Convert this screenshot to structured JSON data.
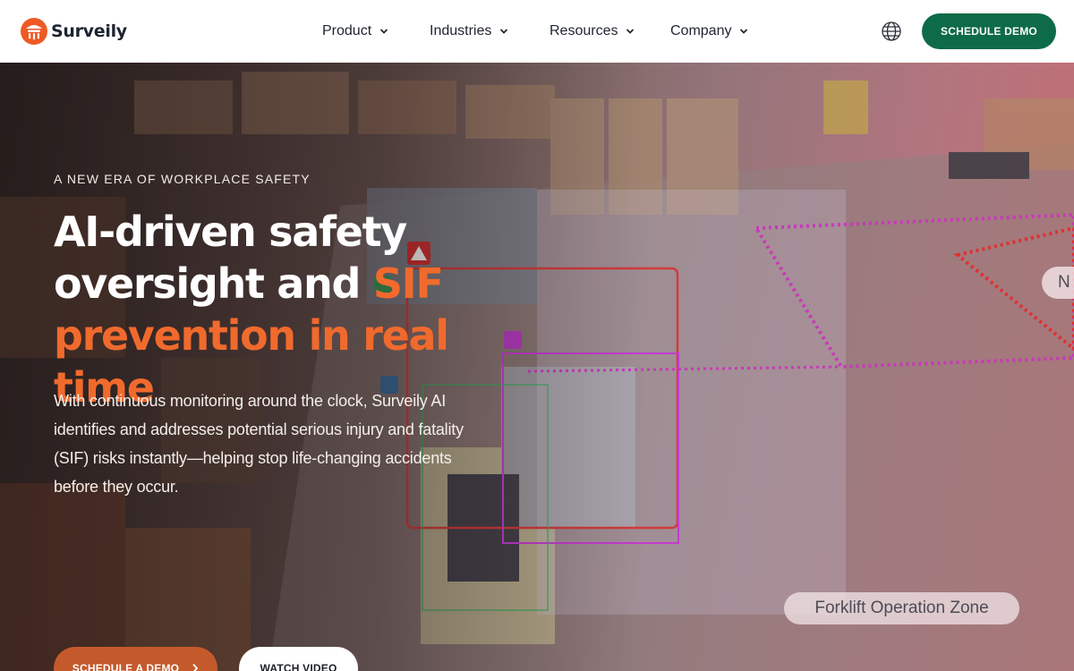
{
  "brand": {
    "name": "Surveily"
  },
  "nav": {
    "items": [
      {
        "label": "Product"
      },
      {
        "label": "Industries"
      },
      {
        "label": "Resources"
      },
      {
        "label": "Company"
      }
    ],
    "cta_label": "SCHEDULE DEMO"
  },
  "hero": {
    "eyebrow": "A NEW ERA OF WORKPLACE SAFETY",
    "headline_line1": "AI-driven safety",
    "headline_line2_white": "oversight and ",
    "headline_line2_accent": "SIF",
    "headline_line3_accent": "prevention in real time",
    "body": "With continuous monitoring around the clock, Surveily AI identifies and addresses potential serious injury and fatality (SIF) risks instantly—helping stop life-changing accidents before they occur.",
    "cta_primary": "SCHEDULE A DEMO",
    "cta_secondary": "WATCH VIDEO",
    "zone_label": "Forklift Operation Zone",
    "side_label": "N"
  },
  "colors": {
    "brand_green": "#0e6b47",
    "accent_orange": "#f06a2d",
    "cta_orange": "#c45a2c",
    "logo_orange": "#ef5a24"
  },
  "icons": {
    "logo": "surveily-logo-icon",
    "nav_chevron": "chevron-down-icon",
    "language": "globe-icon",
    "cta_arrow": "chevron-right-icon"
  }
}
